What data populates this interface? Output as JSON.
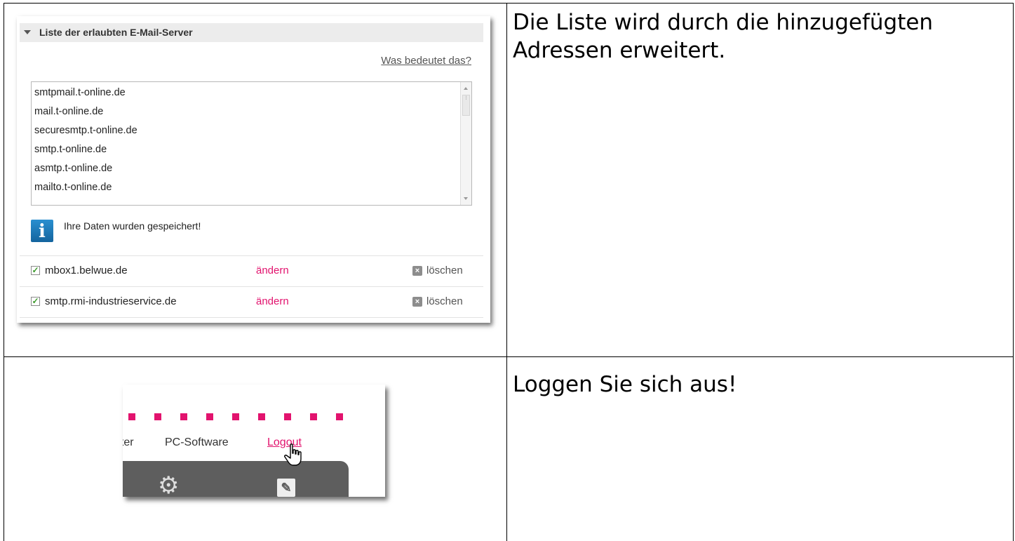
{
  "row1": {
    "caption": "Die Liste wird durch die hinzugefügten Adressen erweitert.",
    "panel": {
      "title": "Liste der erlaubten E-Mail-Server",
      "help_link": "Was bedeutet das?",
      "servers_list": [
        "smtpmail.t-online.de",
        "mail.t-online.de",
        "securesmtp.t-online.de",
        "smtp.t-online.de",
        "asmtp.t-online.de",
        "mailto.t-online.de"
      ],
      "info_message": "Ihre Daten wurden gespeichert!",
      "entries": [
        {
          "name": "mbox1.belwue.de",
          "edit_label": "ändern",
          "delete_label": "löschen",
          "checked": true
        },
        {
          "name": "smtp.rmi-industrieservice.de",
          "edit_label": "ändern",
          "delete_label": "löschen",
          "checked": true
        }
      ]
    }
  },
  "row2": {
    "caption": "Loggen Sie sich aus!",
    "nav": {
      "items": [
        "nter",
        "PC-Software",
        "Logout"
      ]
    }
  },
  "colors": {
    "accent": "#e2136e",
    "info_blue": "#1a78b8",
    "dark_bar": "#5e5e5e"
  },
  "icons": [
    "chevron-down-icon",
    "info-icon",
    "checkbox-checked-icon",
    "close-icon",
    "gear-icon",
    "tools-icon",
    "hand-pointer-cursor-icon"
  ]
}
